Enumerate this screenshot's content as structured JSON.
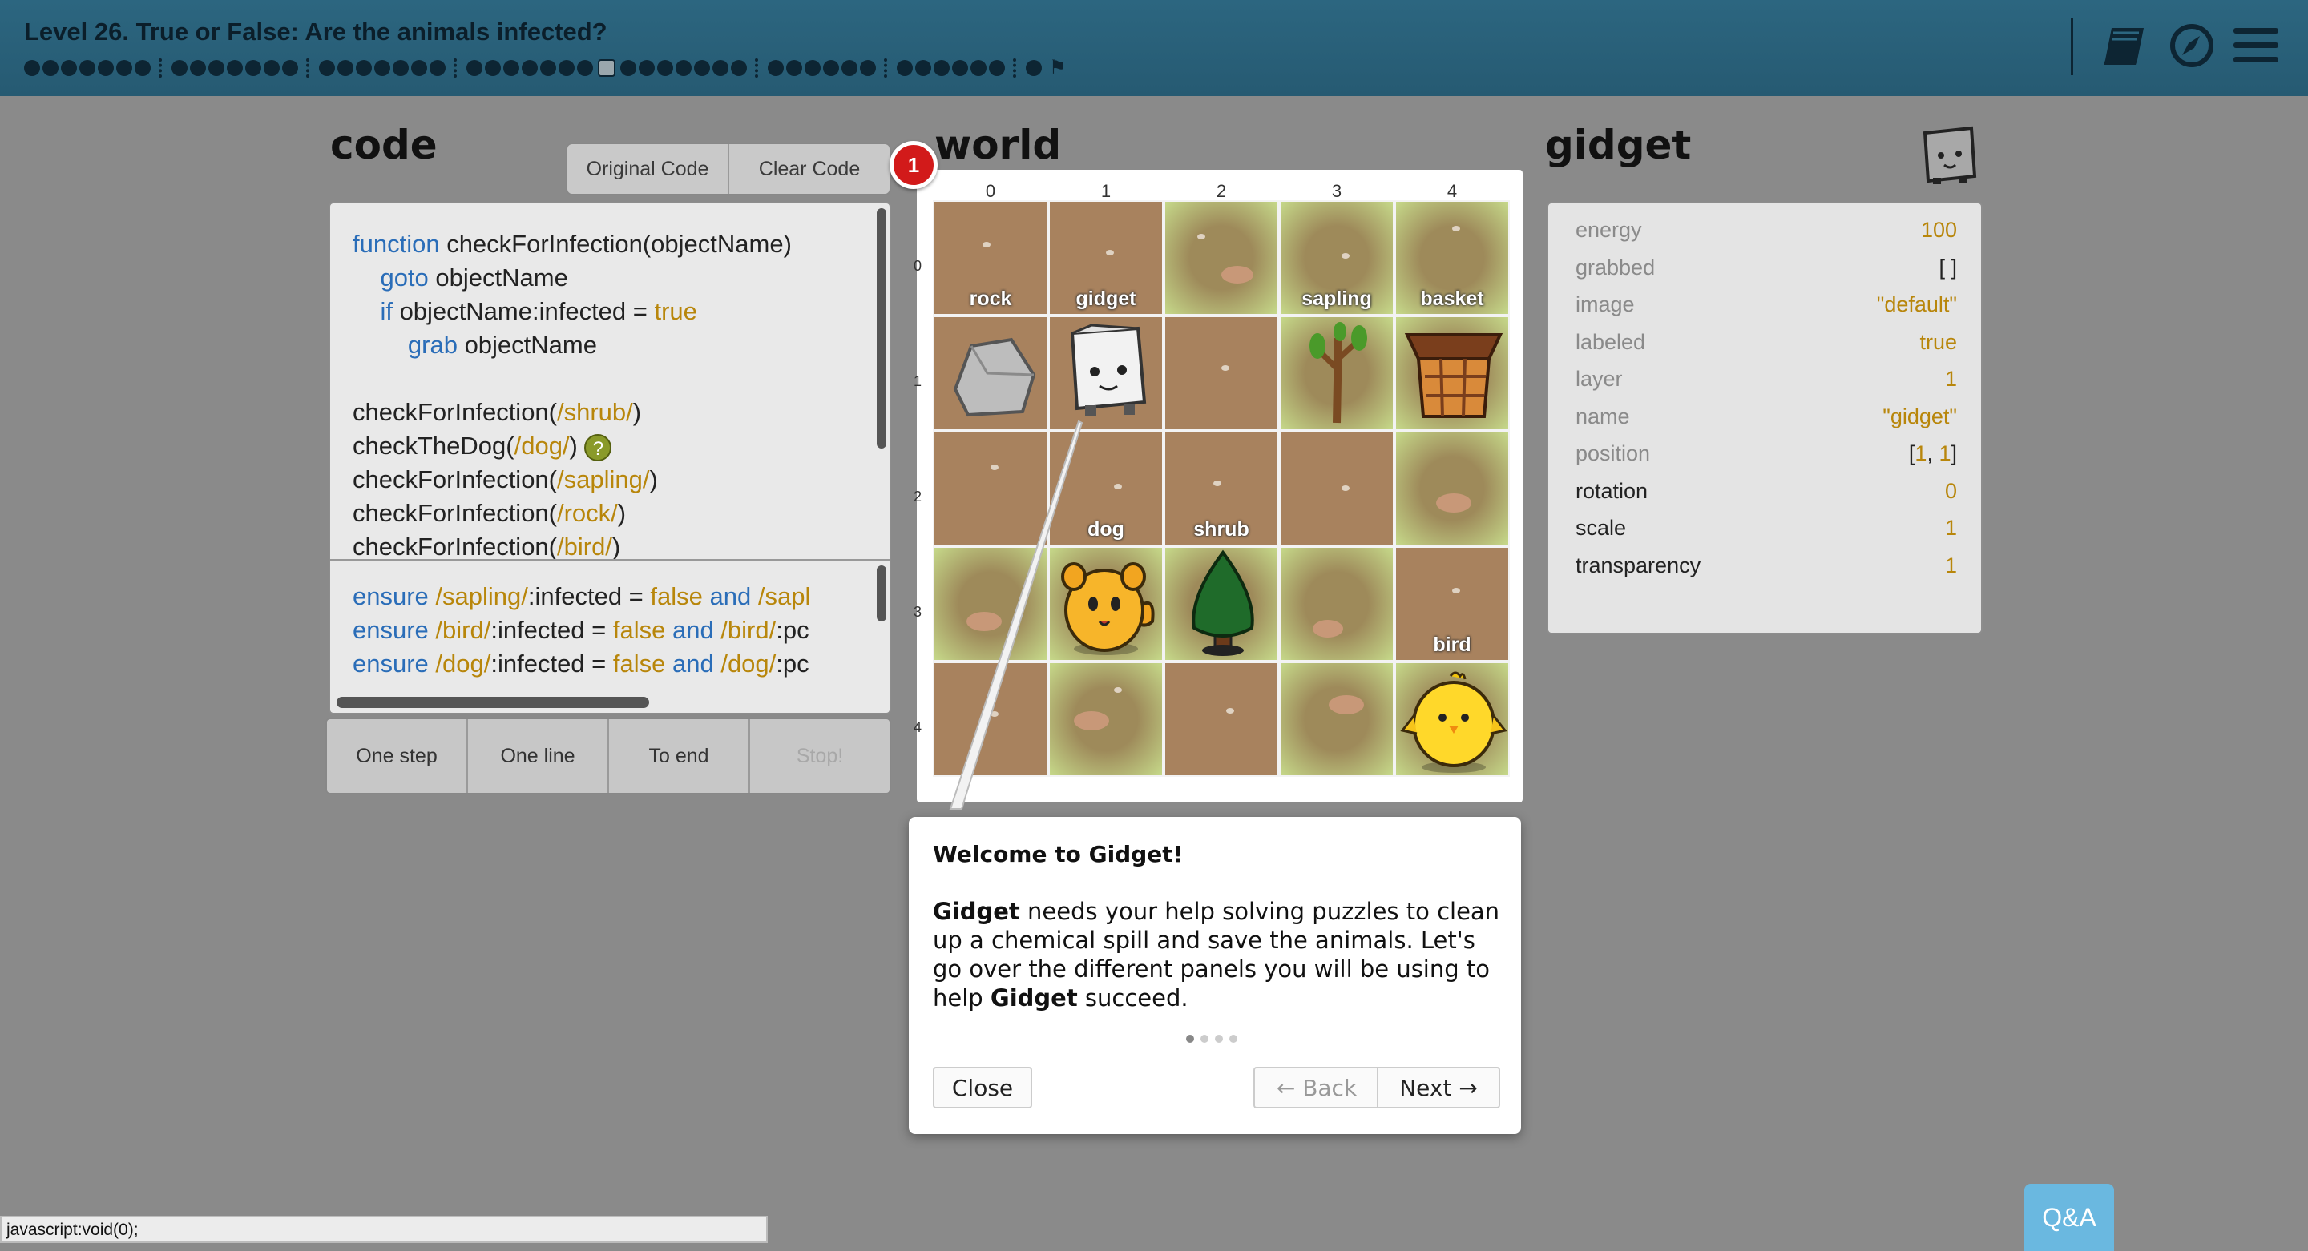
{
  "header": {
    "title": "Level 26. True or False: Are the animals infected?",
    "progress_groups": [
      7,
      7,
      7,
      7,
      7,
      6
    ],
    "progress_current_after_group": 4,
    "progress_tail": [
      6,
      1
    ]
  },
  "top_icons": [
    "book-icon",
    "compass-icon",
    "menu-icon"
  ],
  "code_panel": {
    "heading": "code",
    "original_code_label": "Original Code",
    "clear_code_label": "Clear Code",
    "lines": [
      [
        {
          "t": "function",
          "c": "kw"
        },
        {
          "t": " checkForInfection(objectName)",
          "c": ""
        }
      ],
      [
        {
          "t": "    ",
          "c": ""
        },
        {
          "t": "goto",
          "c": "kw"
        },
        {
          "t": " objectName",
          "c": ""
        }
      ],
      [
        {
          "t": "    ",
          "c": ""
        },
        {
          "t": "if",
          "c": "kw"
        },
        {
          "t": " objectName:infected = ",
          "c": ""
        },
        {
          "t": "true",
          "c": "lit"
        }
      ],
      [
        {
          "t": "        ",
          "c": ""
        },
        {
          "t": "grab",
          "c": "kw"
        },
        {
          "t": " objectName",
          "c": ""
        }
      ],
      [
        {
          "t": "",
          "c": ""
        }
      ],
      [
        {
          "t": "checkForInfection(",
          "c": ""
        },
        {
          "t": "/shrub/",
          "c": "lit"
        },
        {
          "t": ")",
          "c": ""
        }
      ],
      [
        {
          "t": "checkTheDog(",
          "c": ""
        },
        {
          "t": "/dog/",
          "c": "lit"
        },
        {
          "t": ") ",
          "c": ""
        }
      ],
      [
        {
          "t": "checkForInfection(",
          "c": ""
        },
        {
          "t": "/sapling/",
          "c": "lit"
        },
        {
          "t": ")",
          "c": ""
        }
      ],
      [
        {
          "t": "checkForInfection(",
          "c": ""
        },
        {
          "t": "/rock/",
          "c": "lit"
        },
        {
          "t": ")",
          "c": ""
        }
      ],
      [
        {
          "t": "checkForInfection(",
          "c": ""
        },
        {
          "t": "/bird/",
          "c": "lit"
        },
        {
          "t": ")",
          "c": ""
        }
      ]
    ],
    "goals": [
      [
        {
          "t": "ensure",
          "c": "kw"
        },
        {
          "t": " /sapling/",
          "c": "lit"
        },
        {
          "t": ":infected = ",
          "c": ""
        },
        {
          "t": "false",
          "c": "lit"
        },
        {
          "t": " and ",
          "c": "kw"
        },
        {
          "t": "/sapl",
          "c": "lit"
        }
      ],
      [
        {
          "t": "ensure",
          "c": "kw"
        },
        {
          "t": " /bird/",
          "c": "lit"
        },
        {
          "t": ":infected = ",
          "c": ""
        },
        {
          "t": "false",
          "c": "lit"
        },
        {
          "t": " and ",
          "c": "kw"
        },
        {
          "t": "/bird/",
          "c": "lit"
        },
        {
          "t": ":pc",
          "c": ""
        }
      ],
      [
        {
          "t": "ensure",
          "c": "kw"
        },
        {
          "t": " /dog/",
          "c": "lit"
        },
        {
          "t": ":infected = ",
          "c": ""
        },
        {
          "t": "false",
          "c": "lit"
        },
        {
          "t": " and ",
          "c": "kw"
        },
        {
          "t": "/dog/",
          "c": "lit"
        },
        {
          "t": ":pc",
          "c": ""
        }
      ]
    ],
    "help_badge": "?"
  },
  "controls": {
    "one_step": "One step",
    "one_line": "One line",
    "to_end": "To end",
    "stop": "Stop!"
  },
  "world": {
    "heading": "world",
    "step_badge": "1",
    "col_labels": [
      "0",
      "1",
      "2",
      "3",
      "4"
    ],
    "row_labels": [
      "0",
      "1",
      "2",
      "3",
      "4"
    ],
    "labels": {
      "rock": "rock",
      "gidget": "gidget",
      "sapling": "sapling",
      "basket": "basket",
      "dog": "dog",
      "shrub": "shrub",
      "bird": "bird"
    }
  },
  "gidget": {
    "heading": "gidget",
    "properties": [
      {
        "key": "energy",
        "value": "100",
        "dim": true,
        "vclass": "num"
      },
      {
        "key": "grabbed",
        "value": "[ ]",
        "dim": true,
        "vclass": "plain"
      },
      {
        "key": "image",
        "value": "\"default\"",
        "dim": true,
        "vclass": "num"
      },
      {
        "key": "labeled",
        "value": "true",
        "dim": true,
        "vclass": "num"
      },
      {
        "key": "layer",
        "value": "1",
        "dim": true,
        "vclass": "num"
      },
      {
        "key": "name",
        "value": "\"gidget\"",
        "dim": true,
        "vclass": "num"
      },
      {
        "key": "position",
        "value": "[1, 1]",
        "dim": true,
        "vclass": "pos"
      },
      {
        "key": "rotation",
        "value": "0",
        "dim": false,
        "vclass": "num"
      },
      {
        "key": "scale",
        "value": "1",
        "dim": false,
        "vclass": "num"
      },
      {
        "key": "transparency",
        "value": "1",
        "dim": false,
        "vclass": "num"
      }
    ]
  },
  "tour": {
    "title": "Welcome to Gidget!",
    "body_parts": [
      {
        "t": "Gidget",
        "b": true
      },
      {
        "t": " needs your help solving puzzles to clean up a chemical spill and save the animals. Let's go over the different panels you will be using to help ",
        "b": false
      },
      {
        "t": "Gidget",
        "b": true
      },
      {
        "t": " succeed.",
        "b": false
      }
    ],
    "step_count": 4,
    "current_step": 1,
    "close_label": "Close",
    "back_label": "← Back",
    "next_label": "Next →"
  },
  "status_bar": "javascript:void(0);",
  "qa_label": "Q&A",
  "colors": {
    "header": "#2c6680",
    "keyword": "#2a6db8",
    "literal": "#b8860b",
    "badge": "#d21a1a",
    "qa": "#6ab8e0"
  }
}
